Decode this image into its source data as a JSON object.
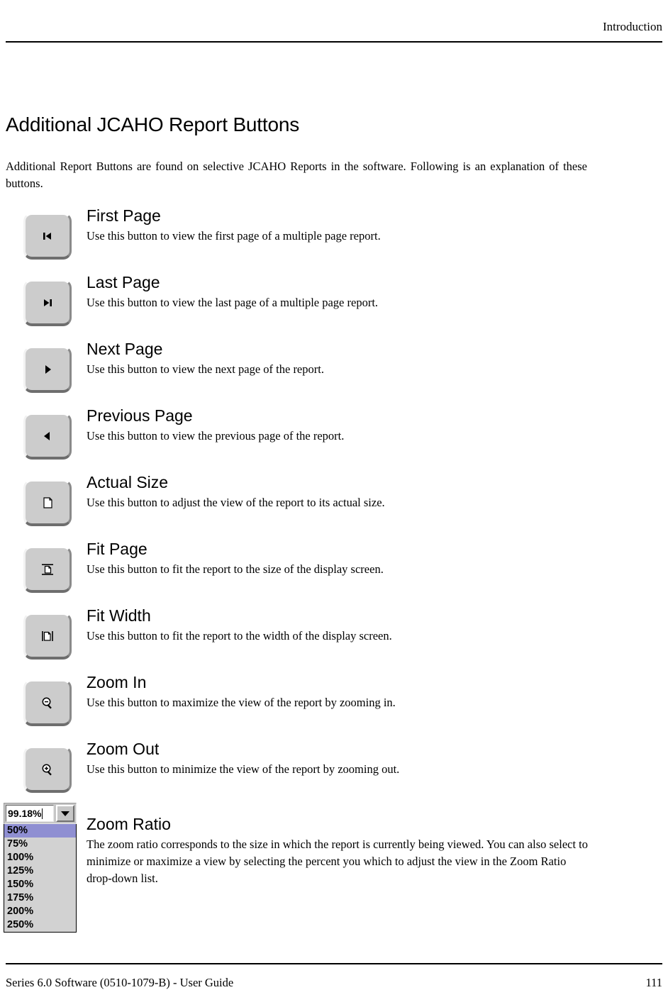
{
  "header": {
    "title": "Introduction"
  },
  "section": {
    "title": "Additional JCAHO Report Buttons",
    "intro": "Additional Report Buttons are found on selective JCAHO Reports in the software. Following is an explanation of these buttons."
  },
  "buttons": [
    {
      "icon": "first-page-icon",
      "title": "First Page",
      "description": "Use this button to view the first page of a multiple page report."
    },
    {
      "icon": "last-page-icon",
      "title": "Last Page",
      "description": "Use this button to view the last page of a multiple page report."
    },
    {
      "icon": "next-page-icon",
      "title": "Next Page",
      "description": "Use this button to view the next page of the report."
    },
    {
      "icon": "previous-page-icon",
      "title": "Previous Page",
      "description": "Use this button to view the previous page of the report."
    },
    {
      "icon": "actual-size-icon",
      "title": "Actual Size",
      "description": "Use this button to adjust the view of the report to its actual size."
    },
    {
      "icon": "fit-page-icon",
      "title": "Fit Page",
      "description": "Use this button to fit the report to the size of the display screen."
    },
    {
      "icon": "fit-width-icon",
      "title": "Fit Width",
      "description": "Use this button to fit the report to the width of the display screen."
    },
    {
      "icon": "zoom-in-icon",
      "title": "Zoom In",
      "description": "Use this button to maximize the view of the report by zooming in."
    },
    {
      "icon": "zoom-out-icon",
      "title": "Zoom Out",
      "description": "Use this button to minimize the view of the report by zooming out."
    }
  ],
  "zoom_ratio": {
    "title": "Zoom Ratio",
    "description": "The zoom ratio corresponds to the size in which the report is currently being viewed. You can also select to minimize or maximize a view by selecting the percent you which to adjust the view in the Zoom Ratio drop-down list.",
    "combo": {
      "value": "99.18%",
      "arrow_icon": "chevron-down-icon",
      "options": [
        "50%",
        "75%",
        "100%",
        "125%",
        "150%",
        "175%",
        "200%",
        "250%"
      ],
      "selected_option": "50%",
      "highlight_color": "#8f8fd2",
      "list_background": "#d2d2d2"
    }
  },
  "footer": {
    "left": "Series 6.0 Software (0510-1079-B) - User Guide",
    "page_number": "111"
  }
}
